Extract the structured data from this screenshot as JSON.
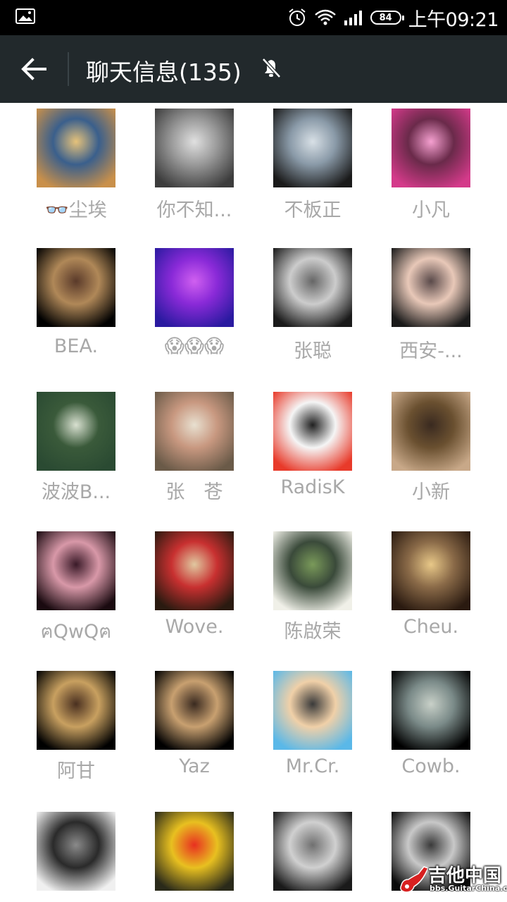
{
  "status_bar": {
    "time": "上午09:21",
    "battery": "84",
    "icons": [
      "gallery-icon",
      "alarm-icon",
      "wifi-icon",
      "signal-icon",
      "battery-icon"
    ]
  },
  "app_bar": {
    "title": "聊天信息(135)",
    "back_icon": "arrow-left-icon",
    "mute_icon": "bell-off-icon"
  },
  "members": [
    {
      "name": "👓尘埃",
      "colors": [
        "#c9904a",
        "#3a5f8c",
        "#e6c27a"
      ]
    },
    {
      "name": "你不知...",
      "colors": [
        "#3c3c3c",
        "#9a9a9a",
        "#e0e0e0"
      ]
    },
    {
      "name": "不板正",
      "colors": [
        "#1a1a1a",
        "#8a9aa8",
        "#d8e0e6"
      ]
    },
    {
      "name": "小凡",
      "colors": [
        "#d43a8a",
        "#6a2a4a",
        "#f5a0d0"
      ]
    },
    {
      "name": "BEA.",
      "colors": [
        "#000000",
        "#b08858",
        "#5a3a2a"
      ]
    },
    {
      "name": "😱😱😱",
      "colors": [
        "#2a1aa0",
        "#8a2ad8",
        "#d060f0"
      ]
    },
    {
      "name": "张聪",
      "colors": [
        "#1a1a1a",
        "#cccccc",
        "#666666"
      ]
    },
    {
      "name": "西安-...",
      "colors": [
        "#1a1a1a",
        "#e8c8b8",
        "#5a4a4a"
      ]
    },
    {
      "name": "波波B...",
      "colors": [
        "#2a4a32",
        "#3a5a3a",
        "#d8e0d0"
      ]
    },
    {
      "name": "张　苍",
      "colors": [
        "#6a5a48",
        "#c89880",
        "#e8e0d0"
      ]
    },
    {
      "name": "RadisK",
      "colors": [
        "#e83a2a",
        "#f5f5f5",
        "#202020"
      ]
    },
    {
      "name": "小新",
      "colors": [
        "#c8a888",
        "#6a5030",
        "#3a2a20"
      ]
    },
    {
      "name": "ฅQwQฅ",
      "colors": [
        "#1a0a10",
        "#d898a8",
        "#3a1a28"
      ]
    },
    {
      "name": "Wove.",
      "colors": [
        "#2a1a10",
        "#c83030",
        "#e0c8a0"
      ]
    },
    {
      "name": "陈啟荣",
      "colors": [
        "#f0f0e8",
        "#3a4a3a",
        "#7a9a5a"
      ]
    },
    {
      "name": "Cheu.",
      "colors": [
        "#2a1a10",
        "#8a6a48",
        "#e8c888"
      ]
    },
    {
      "name": "阿甘",
      "colors": [
        "#000000",
        "#c8a060",
        "#4a3020"
      ]
    },
    {
      "name": "Yaz",
      "colors": [
        "#000000",
        "#c8a070",
        "#3a2a20"
      ]
    },
    {
      "name": "Mr.Cr.",
      "colors": [
        "#5ab8e8",
        "#f0d0a8",
        "#3a3a3a"
      ]
    },
    {
      "name": "Cowb.",
      "colors": [
        "#000000",
        "#7a8a88",
        "#c8d0c8"
      ]
    },
    {
      "name": "",
      "colors": [
        "#f0f0f0",
        "#2a2a2a",
        "#8a8a8a"
      ]
    },
    {
      "name": "",
      "colors": [
        "#2a2a1a",
        "#e8c020",
        "#e83020"
      ]
    },
    {
      "name": "",
      "colors": [
        "#1a1a1a",
        "#d0d0d0",
        "#707070"
      ]
    },
    {
      "name": "",
      "colors": [
        "#0a0a0a",
        "#c8c8c8",
        "#3a3a3a"
      ]
    }
  ],
  "watermark": {
    "title": "吉他中国",
    "url": "bbs.GuitarChina.com"
  }
}
